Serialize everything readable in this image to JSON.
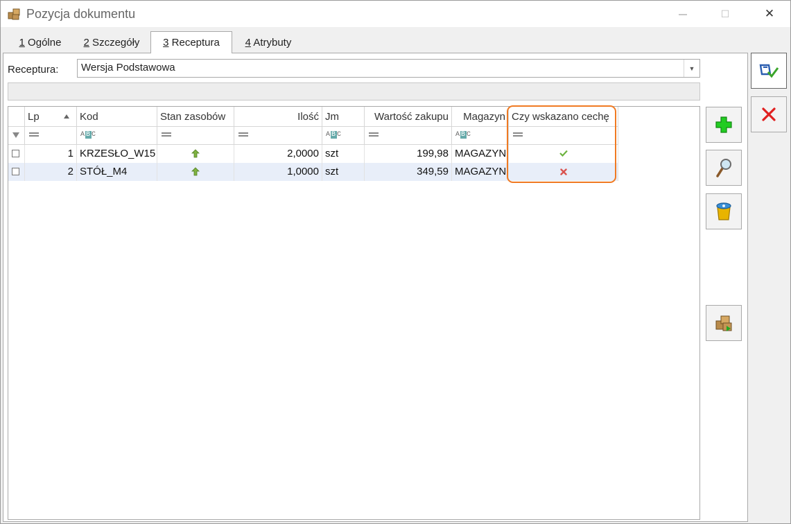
{
  "window": {
    "title": "Pozycja dokumentu",
    "minimize_glyph": "—",
    "maximize_glyph": "☐",
    "close_glyph": "✕"
  },
  "tabs": [
    {
      "key": "1",
      "label": " Ogólne",
      "active": false
    },
    {
      "key": "2",
      "label": " Szczegóły",
      "active": false
    },
    {
      "key": "3",
      "label": " Receptura",
      "active": true
    },
    {
      "key": "4",
      "label": " Atrybuty",
      "active": false
    }
  ],
  "receptura": {
    "label": "Receptura:",
    "value": "Wersja Podstawowa"
  },
  "grid": {
    "columns": [
      "Lp",
      "Kod",
      "Stan zasobów",
      "Ilość",
      "Jm",
      "Wartość zakupu",
      "Magazyn",
      "Czy wskazano cechę"
    ],
    "rows": [
      {
        "lp": "1",
        "kod": "KRZESŁO_W15",
        "stan": "up-arrow-icon",
        "ilosc": "2,0000",
        "jm": "szt",
        "wartosc": "199,98",
        "magazyn": "MAGAZYN",
        "cecha": "check-icon"
      },
      {
        "lp": "2",
        "kod": "STÓŁ_M4",
        "stan": "up-arrow-icon",
        "ilosc": "1,0000",
        "jm": "szt",
        "wartosc": "349,59",
        "magazyn": "MAGAZYN",
        "cecha": "cross-icon"
      }
    ]
  },
  "side_buttons": [
    "add-icon",
    "magnifier-icon",
    "trash-icon",
    "boxes-icon"
  ],
  "right_buttons": [
    "save-icon",
    "cancel-icon"
  ],
  "colors": {
    "highlight": "#f07a22",
    "selected_row": "#e8eef9",
    "check": "#6db33f",
    "cross": "#d9534f",
    "add": "#22aa22",
    "cancel": "#e02020"
  }
}
